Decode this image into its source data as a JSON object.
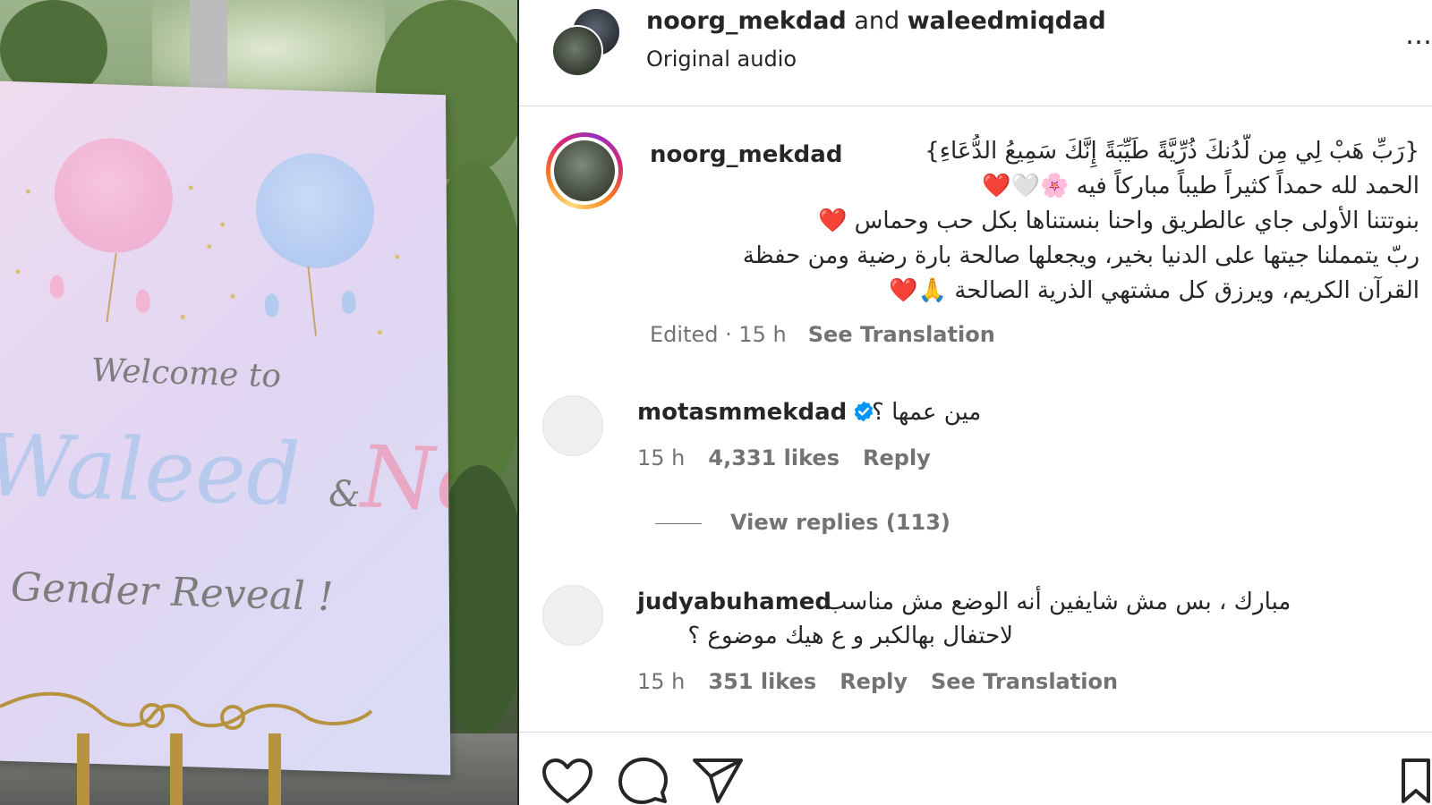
{
  "media": {
    "poster": {
      "welcome": "Welcome to",
      "name1": "Waleed",
      "amp": "&",
      "name2": "Noor's",
      "reveal": "Gender Reveal !"
    }
  },
  "header": {
    "user1": "noorg_mekdad",
    "joiner": " and ",
    "user2": "waleedmiqdad",
    "audio": "Original audio",
    "more": "…"
  },
  "caption": {
    "username": "noorg_mekdad",
    "lines": [
      "{رَبِّ هَبْ لِي مِن لَّدُنكَ ذُرِّيَّةً طَيِّبَةً إِنَّكَ سَمِيعُ الدُّعَاءِ}",
      "الحمد لله حمداً كثيراً طيباً مباركاً فيه 🌸🤍❤️",
      "بنوتتنا الأولى جاي عالطريق واحنا بنستناها بكل حب وحماس ❤️",
      "ربّ يتمملنا جيتها على الدنيا بخير، ويجعلها صالحة بارة رضية ومن حفظة",
      "القرآن الكريم، ويرزق كل مشتهي الذرية الصالحة 🙏❤️"
    ],
    "edited": "Edited · 15 h",
    "see_translation": "See Translation"
  },
  "comments": [
    {
      "username": "motasmmekdad",
      "verified": true,
      "text": "مين عمها ؟",
      "time": "15 h",
      "likes": "4,331 likes",
      "reply": "Reply",
      "view_replies": "View replies (113)"
    },
    {
      "username": "judyabuhamed",
      "verified": false,
      "text_line1": "مبارك ، بس مش شايفين أنه الوضع مش مناسب",
      "text_line2": "لاحتفال بهالكبر و ع هيك موضوع ؟",
      "time": "15 h",
      "likes": "351 likes",
      "reply": "Reply",
      "see_translation": "See Translation"
    }
  ],
  "actions": {
    "like_icon": "heart-icon",
    "comment_icon": "comment-icon",
    "share_icon": "share-icon",
    "save_icon": "bookmark-icon"
  },
  "colors": {
    "text": "#262626",
    "secondary": "#737373",
    "verified": "#0095f6",
    "divider": "#dbdbdb"
  }
}
